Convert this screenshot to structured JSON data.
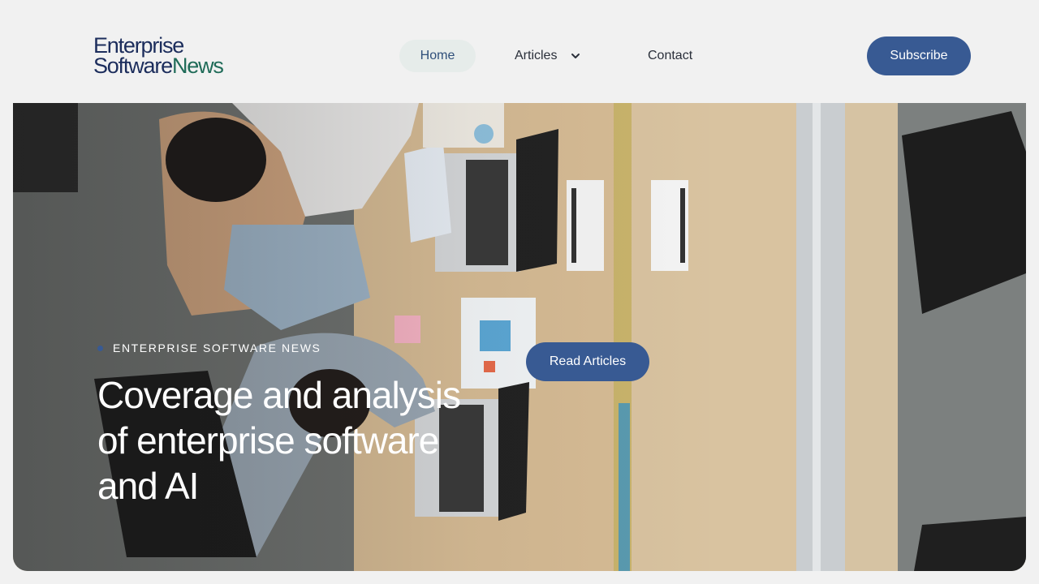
{
  "brand": {
    "line1": "Enterprise",
    "line2_main": "Software",
    "line2_accent": "News"
  },
  "nav": {
    "items": [
      {
        "label": "Home",
        "active": true
      },
      {
        "label": "Articles",
        "has_dropdown": true
      },
      {
        "label": "Contact"
      }
    ]
  },
  "header": {
    "subscribe_label": "Subscribe"
  },
  "hero": {
    "eyebrow": "ENTERPRISE SOFTWARE NEWS",
    "headline": "Coverage and analysis of enterprise software and AI",
    "cta_label": "Read Articles",
    "image_description_icon": "office-workspace-photo"
  },
  "colors": {
    "brand_navy": "#1c2d5c",
    "brand_green": "#1f6b58",
    "button_blue": "#385a93",
    "page_bg": "#f1f1f1"
  }
}
